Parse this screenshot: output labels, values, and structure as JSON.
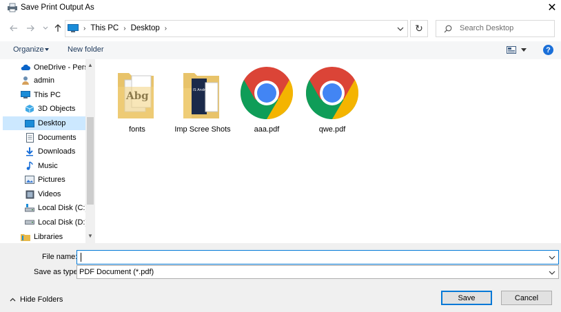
{
  "window": {
    "title": "Save Print Output As",
    "close_glyph": "✕"
  },
  "address": {
    "crumbs": [
      "This PC",
      "Desktop"
    ],
    "refresh_glyph": "↻"
  },
  "search": {
    "placeholder": "Search Desktop"
  },
  "toolbar": {
    "organize_label": "Organize",
    "new_folder_label": "New folder",
    "help_label": "?"
  },
  "nav": {
    "items": [
      {
        "label": "OneDrive - Perso",
        "icon": "cloud-icon"
      },
      {
        "label": "admin",
        "icon": "user-icon"
      },
      {
        "label": "This PC",
        "icon": "computer-icon"
      },
      {
        "label": "3D Objects",
        "icon": "cube-icon"
      },
      {
        "label": "Desktop",
        "icon": "desktop-icon",
        "selected": true
      },
      {
        "label": "Documents",
        "icon": "document-icon"
      },
      {
        "label": "Downloads",
        "icon": "download-icon"
      },
      {
        "label": "Music",
        "icon": "music-icon"
      },
      {
        "label": "Pictures",
        "icon": "picture-icon"
      },
      {
        "label": "Videos",
        "icon": "video-icon"
      },
      {
        "label": "Local Disk (C:)",
        "icon": "drive-icon"
      },
      {
        "label": "Local Disk (D:)",
        "icon": "drive-icon"
      },
      {
        "label": "Libraries",
        "icon": "library-icon"
      }
    ]
  },
  "files": [
    {
      "name": "fonts",
      "type": "folder",
      "icon": "fonts-folder-icon"
    },
    {
      "name": "Imp Scree Shots",
      "type": "folder",
      "icon": "screenshots-folder-icon"
    },
    {
      "name": "aaa.pdf",
      "type": "pdf",
      "icon": "chrome-icon"
    },
    {
      "name": "qwe.pdf",
      "type": "pdf",
      "icon": "chrome-icon"
    }
  ],
  "form": {
    "file_name_label": "File name:",
    "file_name_value": "",
    "save_as_type_label": "Save as type:",
    "save_as_type_value": "PDF Document (*.pdf)"
  },
  "footer": {
    "hide_folders_label": "Hide Folders",
    "save_label": "Save",
    "cancel_label": "Cancel"
  },
  "colors": {
    "accent": "#0078d7",
    "selected_bg": "#cce8ff",
    "toolbar_bg": "#f5f6f7",
    "bottom_bg": "#f0f0f0",
    "link": "#1e395b"
  }
}
